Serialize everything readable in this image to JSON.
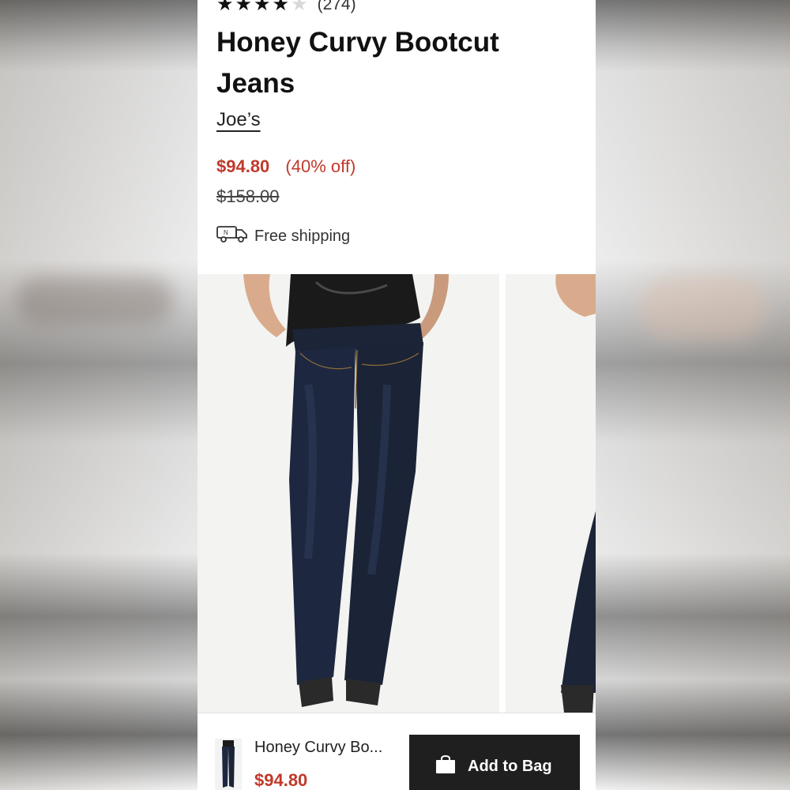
{
  "product": {
    "rating": {
      "value": 4,
      "max": 5,
      "count_text": "(274)"
    },
    "title": "Honey Curvy Bootcut Jeans",
    "brand": "Joe’s",
    "sale_price": "$94.80",
    "discount": "(40% off)",
    "original_price": "$158.00",
    "shipping_text": "Free shipping"
  },
  "sticky_bar": {
    "name": "Honey Curvy Bo...",
    "price": "$94.80",
    "add_to_bag_label": "Add to Bag",
    "icon": "shopping-bag-icon"
  },
  "colors": {
    "sale_red": "#c0392b",
    "button_dark": "#1f1f1f",
    "denim": "#1c2438"
  }
}
